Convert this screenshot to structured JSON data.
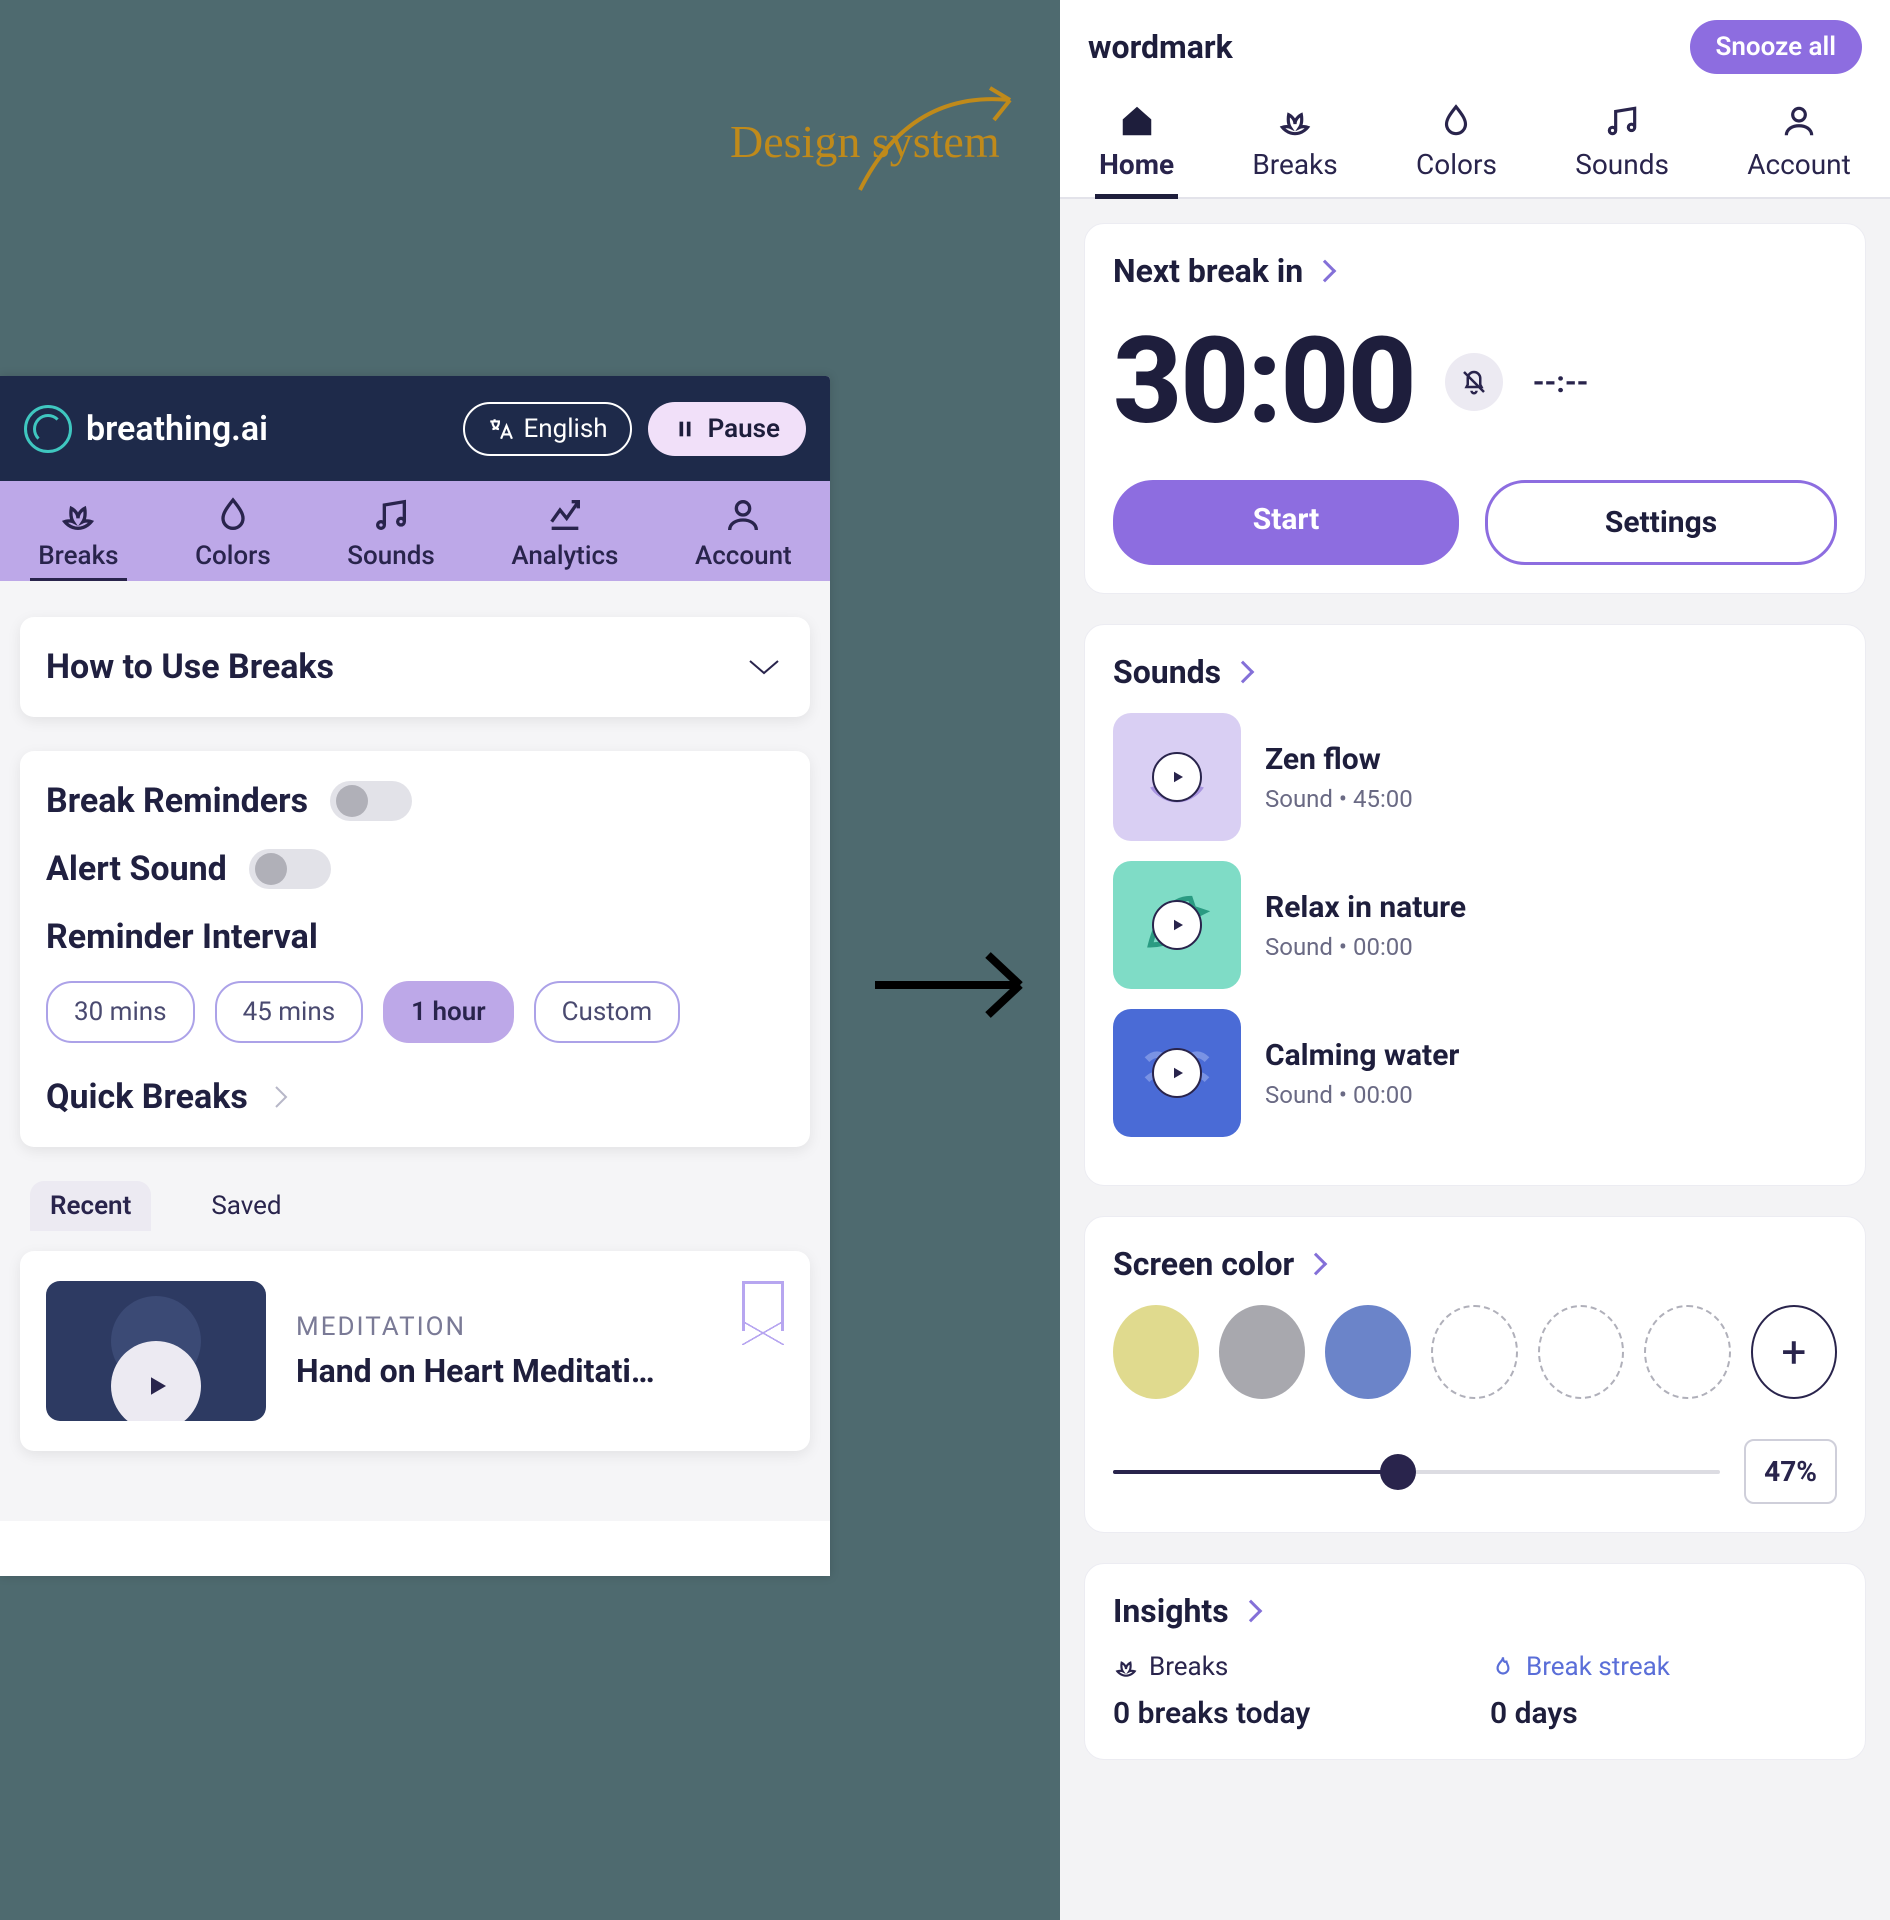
{
  "annotation": "Design system",
  "left": {
    "logo_text": "breathing.ai",
    "lang_btn": "English",
    "pause_btn": "Pause",
    "tabs": [
      "Breaks",
      "Colors",
      "Sounds",
      "Analytics",
      "Account"
    ],
    "active_tab": 0,
    "howto_title": "How to Use Breaks",
    "break_reminders_label": "Break Reminders",
    "alert_sound_label": "Alert Sound",
    "reminder_interval_label": "Reminder Interval",
    "intervals": [
      "30 mins",
      "45 mins",
      "1 hour",
      "Custom"
    ],
    "selected_interval": "1 hour",
    "quick_breaks_label": "Quick Breaks",
    "subtabs": [
      "Recent",
      "Saved"
    ],
    "active_subtab": "Recent",
    "media_category": "MEDITATION",
    "media_title": "Hand on Heart Meditati…"
  },
  "right": {
    "wordmark": "wordmark",
    "snooze_all": "Snooze all",
    "tabs": [
      "Home",
      "Breaks",
      "Colors",
      "Sounds",
      "Account"
    ],
    "active_tab": 0,
    "next_break_title": "Next break in",
    "timer": "30:00",
    "secondary_time": "--:--",
    "start_btn": "Start",
    "settings_btn": "Settings",
    "sounds_title": "Sounds",
    "sounds": [
      {
        "name": "Zen flow",
        "meta": "Sound • 45:00",
        "style": "zen"
      },
      {
        "name": "Relax in nature",
        "meta": "Sound • 00:00",
        "style": "nature"
      },
      {
        "name": "Calming water",
        "meta": "Sound • 00:00",
        "style": "water"
      }
    ],
    "screen_color_title": "Screen color",
    "brightness_pct": "47%",
    "insights_title": "Insights",
    "insights": {
      "breaks_label": "Breaks",
      "breaks_value": "0 breaks today",
      "streak_label": "Break streak",
      "streak_value": "0 days"
    }
  }
}
